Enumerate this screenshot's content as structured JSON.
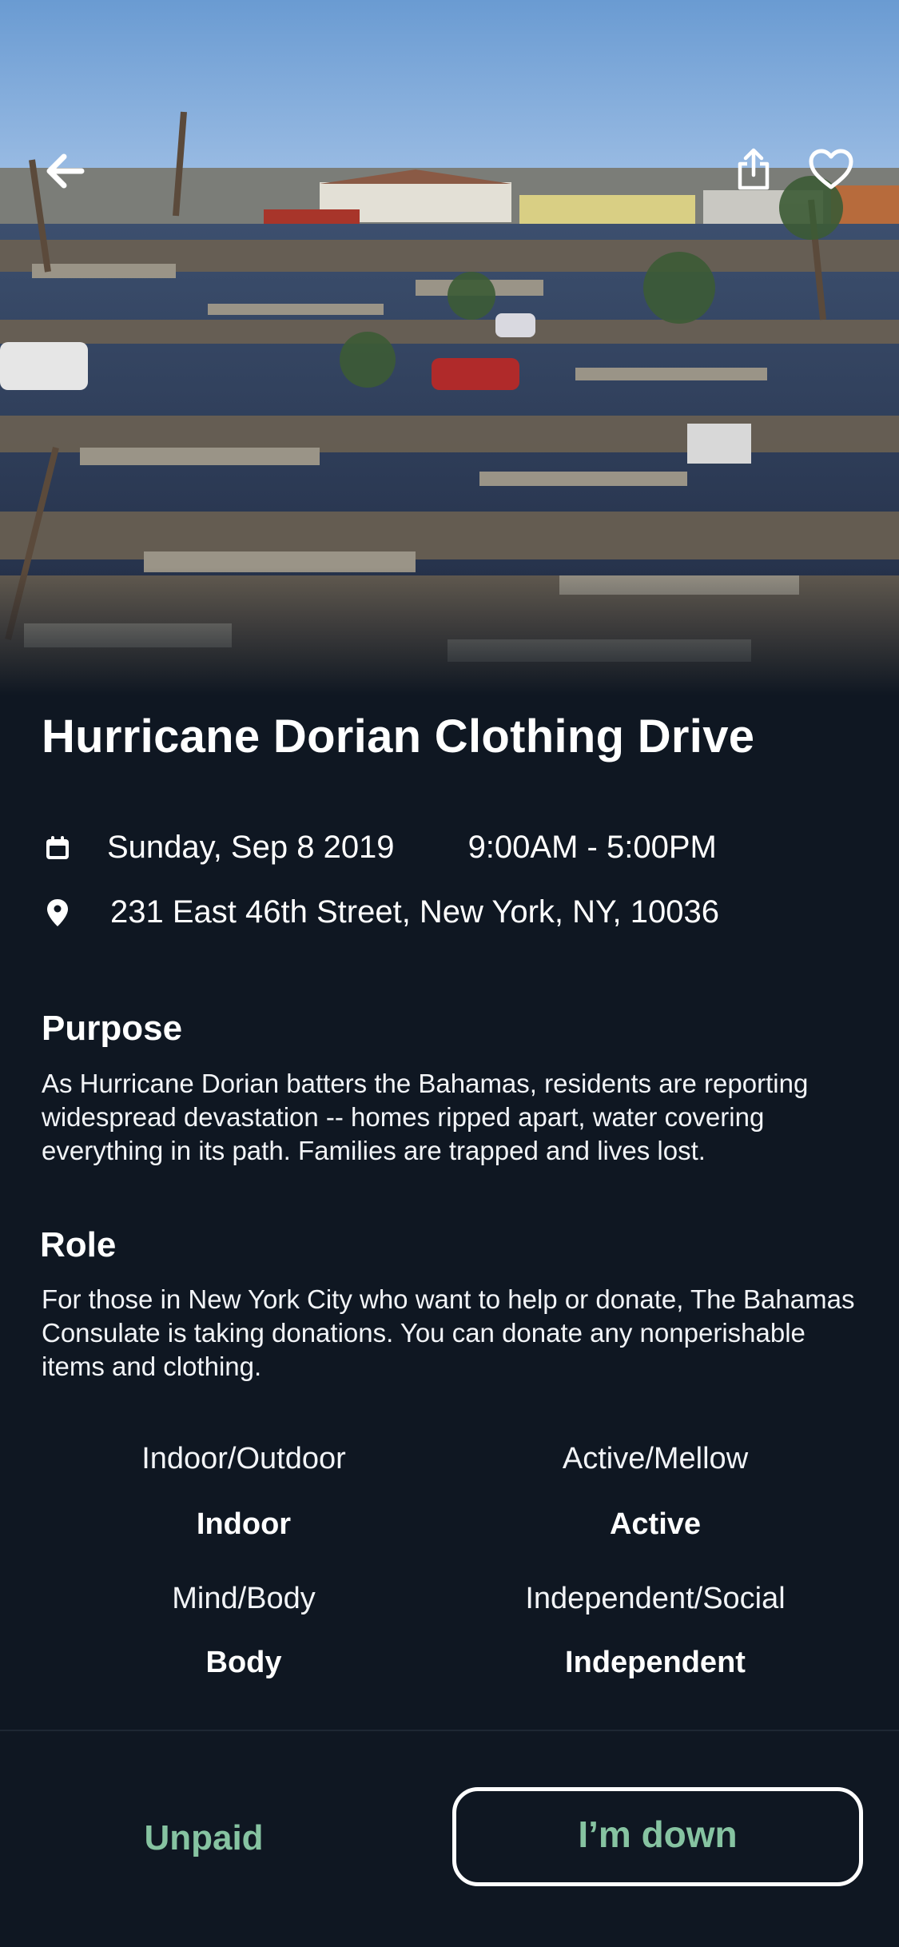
{
  "event": {
    "title": "Hurricane Dorian Clothing Drive",
    "date": "Sunday, Sep 8 2019",
    "time": "9:00AM - 5:00PM",
    "address": "231 East 46th Street, New York, NY, 10036"
  },
  "purpose": {
    "heading": "Purpose",
    "text": "As Hurricane Dorian batters the Bahamas, residents are reporting widespread devastation -- homes ripped apart, water covering everything in its path. Families are trapped and lives lost."
  },
  "role": {
    "heading": "Role",
    "text": "For those in New York City who want to help or donate, The Bahamas Consulate is taking donations. You can donate any nonperishable items and clothing."
  },
  "attributes": [
    {
      "label": "Indoor/Outdoor",
      "value": "Indoor"
    },
    {
      "label": "Active/Mellow",
      "value": "Active"
    },
    {
      "label": "Mind/Body",
      "value": "Body"
    },
    {
      "label": "Independent/Social",
      "value": "Independent"
    }
  ],
  "footer": {
    "pay_status": "Unpaid",
    "cta_label": "I’m down"
  },
  "colors": {
    "background": "#0f1722",
    "accent_green": "#86c3a1",
    "text": "#ffffff"
  },
  "icons": {
    "back": "back-arrow-icon",
    "share": "share-icon",
    "favorite": "heart-icon",
    "date": "calendar-icon",
    "location": "location-pin-icon"
  }
}
